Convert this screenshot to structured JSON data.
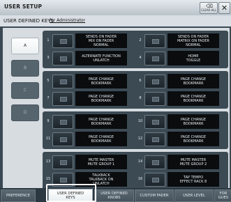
{
  "window": {
    "title": "USER SETUP",
    "clear_all_label": "CLEAR ALL",
    "close_symbol": "✕"
  },
  "header": {
    "section_title": "USER DEFINED KEYS",
    "user_label": "for Administrator"
  },
  "banks": [
    {
      "label": "A",
      "active": true
    },
    {
      "label": "B",
      "active": false
    },
    {
      "label": "C",
      "active": false
    },
    {
      "label": "D",
      "active": false
    }
  ],
  "keys": [
    {
      "num": "1",
      "lines": [
        "SENDS ON FADER",
        "MIX ON FADER",
        "NORMAL"
      ]
    },
    {
      "num": "2",
      "lines": [
        "SENDS ON FADER",
        "MATRIX ON FADER",
        "NORMAL"
      ]
    },
    {
      "num": "3",
      "lines": [
        "ALTERNATE FUNCTION",
        "UNLATCH"
      ]
    },
    {
      "num": "4",
      "lines": [
        "HOME",
        "TOGGLE"
      ]
    },
    {
      "num": "5",
      "lines": [
        "PAGE CHANGE",
        "BOOKMARK"
      ]
    },
    {
      "num": "6",
      "lines": [
        "PAGE CHANGE",
        "BOOKMARK"
      ]
    },
    {
      "num": "7",
      "lines": [
        "PAGE CHANGE",
        "BOOKMARK"
      ]
    },
    {
      "num": "8",
      "lines": [
        "PAGE CHANGE",
        "BOOKMARK"
      ]
    },
    {
      "num": "9",
      "lines": [
        "PAGE CHANGE",
        "BOOKMARK"
      ]
    },
    {
      "num": "10",
      "lines": [
        "PAGE CHANGE",
        "BOOKMARK"
      ]
    },
    {
      "num": "11",
      "lines": [
        "PAGE CHANGE",
        "BOOKMARK"
      ]
    },
    {
      "num": "12",
      "lines": [
        "PAGE CHANGE",
        "BOOKMARK"
      ]
    },
    {
      "num": "13",
      "lines": [
        "MUTE MASTER",
        "MUTE GROUP 1"
      ]
    },
    {
      "num": "14",
      "lines": [
        "MUTE MASTER",
        "MUTE GROUP 2"
      ]
    },
    {
      "num": "15",
      "lines": [
        "TALKBACK",
        "TALKBACK ON",
        "UNLATCH"
      ]
    },
    {
      "num": "16",
      "lines": [
        "TAP TEMPO",
        "EFFECT RACK 8"
      ]
    }
  ],
  "bottom_tabs": [
    {
      "lines": [
        "PREFERENCE"
      ],
      "active": false
    },
    {
      "lines": [
        "USER DEFINED",
        "KEYS"
      ],
      "active": true
    },
    {
      "lines": [
        "USER DEFINED",
        "KNOBS"
      ],
      "active": false
    },
    {
      "lines": [
        "CUSTOM FADER"
      ],
      "active": false
    },
    {
      "lines": [
        "USER LEVEL"
      ],
      "active": false
    },
    {
      "lines": [
        "FOR",
        "GUES"
      ],
      "active": false
    }
  ],
  "colors": {
    "accent_highlight": "#ffffff",
    "key_label_bg": "#0a0c0e",
    "panel_bg": "#3c4a54"
  }
}
